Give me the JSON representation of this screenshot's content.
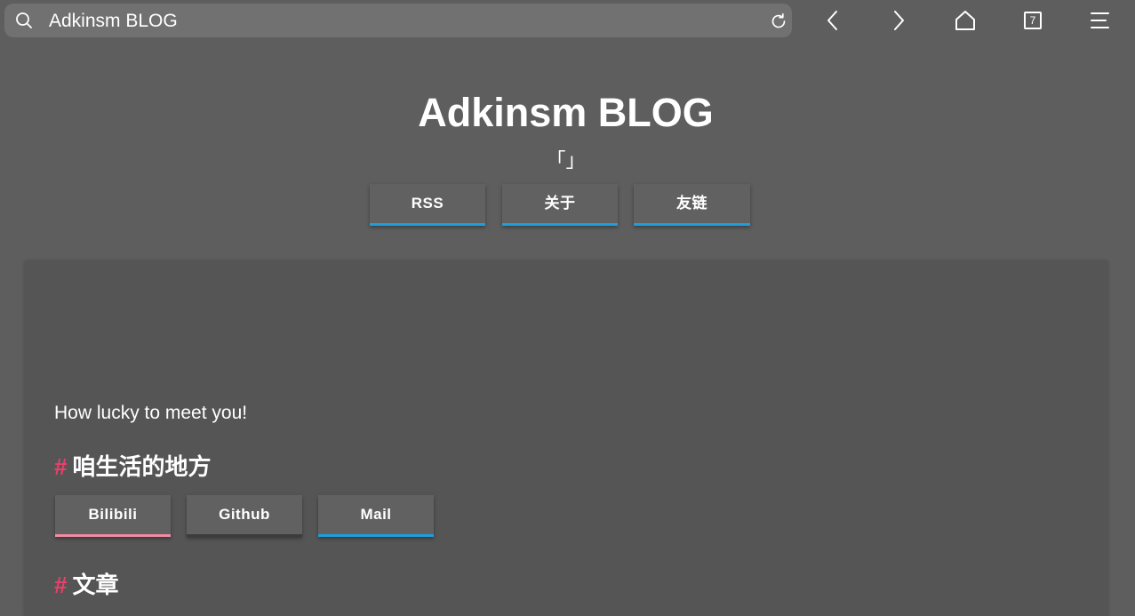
{
  "browser": {
    "url_text": "Adkinsm BLOG",
    "tab_count": "7",
    "icons": [
      "search-icon",
      "reload-icon",
      "back-icon",
      "forward-icon",
      "home-icon",
      "tabs-icon",
      "menu-icon"
    ]
  },
  "header": {
    "title": "Adkinsm BLOG",
    "quote": "「」",
    "nav_buttons": [
      {
        "label": "RSS"
      },
      {
        "label": "关于"
      },
      {
        "label": "友链"
      }
    ]
  },
  "main": {
    "greeting": "How lucky to meet you!",
    "sections": [
      {
        "hash": "#",
        "title": "咱生活的地方"
      },
      {
        "hash": "#",
        "title": "文章"
      }
    ],
    "social_buttons": [
      {
        "label": "Bilibili"
      },
      {
        "label": "Github"
      },
      {
        "label": "Mail"
      }
    ]
  },
  "colors": {
    "background": "#5e5e5e",
    "card": "#555555",
    "accent_blue": "#1e9fdc",
    "accent_pink": "#f28ba3",
    "hash_red": "#ec3f6b"
  }
}
